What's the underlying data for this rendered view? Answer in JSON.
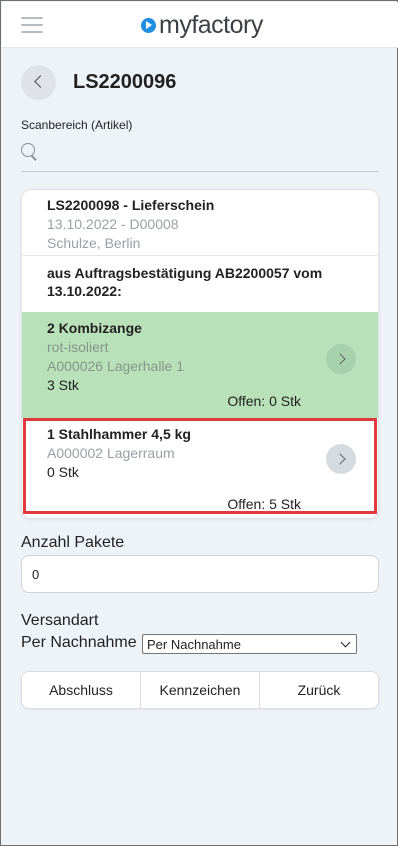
{
  "app": {
    "logo_text": "myfactory",
    "accent_color": "#1e8fe1"
  },
  "header": {
    "menu_icon": "hamburger-icon",
    "back_icon": "chevron-left-icon",
    "title": "LS2200096"
  },
  "scan": {
    "label": "Scanbereich (Artikel)",
    "placeholder": "",
    "value": "",
    "icon": "search-icon"
  },
  "delivery": {
    "title": "LS2200098 - Lieferschein",
    "date_line": "13.10.2022 - D00008",
    "customer": "Schulze, Berlin"
  },
  "order_reference": "aus Auftragsbestätigung AB2200057 vom 13.10.2022:",
  "items": [
    {
      "name": "2 Kombizange",
      "detail": "rot-isoliert",
      "location": "A000026 Lagerhalle 1",
      "quantity": "3 Stk",
      "open": "Offen: 0 Stk",
      "status_color": "#b9e1b9",
      "icon": "chevron-right-icon"
    },
    {
      "name": "1 Stahlhammer 4,5 kg",
      "location": "A000002 Lagerraum",
      "quantity": "0 Stk",
      "open": "Offen: 5 Stk",
      "highlight_color": "#e03a3e",
      "icon": "chevron-right-icon"
    }
  ],
  "packages": {
    "label": "Anzahl Pakete",
    "value": "0"
  },
  "shipping": {
    "label": "Versandart",
    "current": "Per Nachnahme",
    "selected_option": "Per Nachnahme"
  },
  "buttons": {
    "finish": "Abschluss",
    "marks": "Kennzeichen",
    "back": "Zurück"
  }
}
